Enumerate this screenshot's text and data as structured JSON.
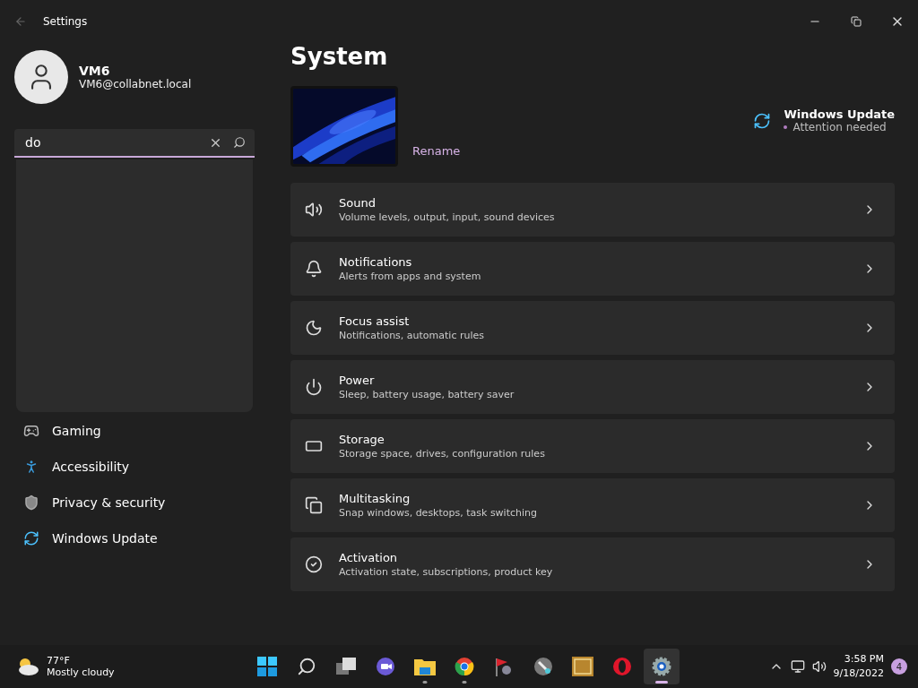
{
  "window": {
    "title": "Settings"
  },
  "user": {
    "name": "VM6",
    "email": "VM6@collabnet.local"
  },
  "search": {
    "value": "do"
  },
  "sidebar": {
    "items": [
      {
        "label": "Gaming",
        "selected": false
      },
      {
        "label": "Accessibility",
        "selected": false
      },
      {
        "label": "Privacy & security",
        "selected": false
      },
      {
        "label": "Windows Update",
        "selected": false
      }
    ]
  },
  "page": {
    "title": "System",
    "rename": "Rename"
  },
  "update": {
    "title": "Windows Update",
    "status": "Attention needed"
  },
  "settings": [
    {
      "title": "Sound",
      "subtitle": "Volume levels, output, input, sound devices"
    },
    {
      "title": "Notifications",
      "subtitle": "Alerts from apps and system"
    },
    {
      "title": "Focus assist",
      "subtitle": "Notifications, automatic rules"
    },
    {
      "title": "Power",
      "subtitle": "Sleep, battery usage, battery saver"
    },
    {
      "title": "Storage",
      "subtitle": "Storage space, drives, configuration rules"
    },
    {
      "title": "Multitasking",
      "subtitle": "Snap windows, desktops, task switching"
    },
    {
      "title": "Activation",
      "subtitle": "Activation state, subscriptions, product key"
    }
  ],
  "taskbar": {
    "weather": {
      "temp": "77°F",
      "condition": "Mostly cloudy"
    },
    "apps": [
      {
        "running": false,
        "selected": false
      },
      {
        "running": false,
        "selected": false
      },
      {
        "running": false,
        "selected": false
      },
      {
        "running": false,
        "selected": false
      },
      {
        "running": true,
        "selected": false
      },
      {
        "running": true,
        "selected": false
      },
      {
        "running": false,
        "selected": false
      },
      {
        "running": false,
        "selected": false
      },
      {
        "running": false,
        "selected": false
      },
      {
        "running": false,
        "selected": false
      },
      {
        "running": true,
        "selected": true
      }
    ],
    "time": "3:58 PM",
    "date": "9/18/2022",
    "notifications": "4"
  }
}
